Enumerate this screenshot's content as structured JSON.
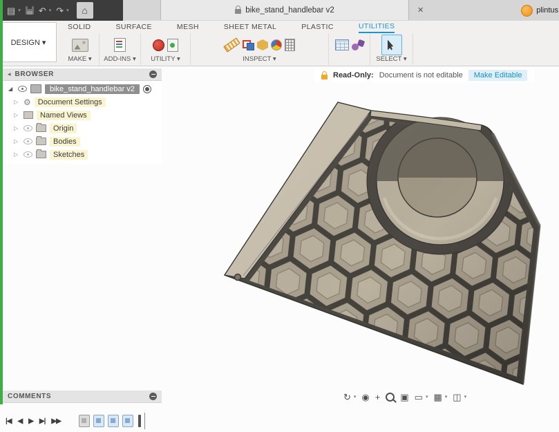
{
  "ui": {
    "caret": "▾",
    "close": "✕",
    "collapsed": "▷",
    "expanded": "◢",
    "gear": "⚙",
    "menu": "▤",
    "undo": "↶",
    "redo": "↷",
    "home": "⌂",
    "browser_collapse": "◂"
  },
  "titlebar": {
    "doc_title": "bike_stand_handlebar v2",
    "username": "plintus"
  },
  "ribbon": {
    "design_label": "DESIGN ▾",
    "tabs": [
      {
        "label": "SOLID",
        "active": false
      },
      {
        "label": "SURFACE",
        "active": false
      },
      {
        "label": "MESH",
        "active": false
      },
      {
        "label": "SHEET METAL",
        "active": false
      },
      {
        "label": "PLASTIC",
        "active": false
      },
      {
        "label": "UTILITIES",
        "active": true
      }
    ],
    "groups": [
      {
        "label": "MAKE ▾"
      },
      {
        "label": "ADD-INS ▾"
      },
      {
        "label": "UTILITY ▾"
      },
      {
        "label": "INSPECT ▾"
      },
      {
        "label": "SELECT ▾"
      }
    ]
  },
  "browser": {
    "title": "BROWSER",
    "root_label": "bike_stand_handlebar v2",
    "items": [
      {
        "label": "Document Settings"
      },
      {
        "label": "Named Views"
      },
      {
        "label": "Origin"
      },
      {
        "label": "Bodies"
      },
      {
        "label": "Sketches"
      }
    ]
  },
  "readonly": {
    "label": "Read-Only:",
    "message": "Document is not editable",
    "action": "Make Editable"
  },
  "comments": {
    "title": "COMMENTS"
  },
  "nav": {
    "icons": [
      {
        "name": "orbit",
        "glyph": "↻"
      },
      {
        "name": "look-at",
        "glyph": "◉"
      },
      {
        "name": "pan",
        "glyph": "+"
      },
      {
        "name": "zoom",
        "glyph": ""
      },
      {
        "name": "fit",
        "glyph": "▣"
      },
      {
        "name": "display-settings",
        "glyph": "▭"
      },
      {
        "name": "grid",
        "glyph": "▦"
      },
      {
        "name": "viewports",
        "glyph": "◫"
      }
    ]
  },
  "timeline": {
    "controls": [
      "|◀",
      "◀",
      "▶",
      "▶|",
      "▶▶"
    ]
  },
  "colors": {
    "accent_blue": "#1696d3",
    "readonly_orange": "#f5a623",
    "model_beige": "#c9c0ae",
    "model_dark": "#4a4742",
    "capture_green": "#3faf45"
  }
}
